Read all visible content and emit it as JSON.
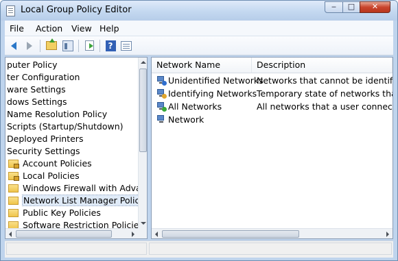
{
  "window": {
    "title": "Local Group Policy Editor"
  },
  "titlebar_buttons": {
    "minimize": "‒",
    "maximize": "□",
    "close": "✕"
  },
  "menu": [
    "File",
    "Action",
    "View",
    "Help"
  ],
  "toolbar": {
    "help_glyph": "?"
  },
  "tree": {
    "items": [
      {
        "label": "puter Policy",
        "icon": "none"
      },
      {
        "label": "ter Configuration",
        "icon": "none"
      },
      {
        "label": "ware Settings",
        "icon": "none"
      },
      {
        "label": "dows Settings",
        "icon": "none"
      },
      {
        "label": "Name Resolution Policy",
        "icon": "none"
      },
      {
        "label": "Scripts (Startup/Shutdown)",
        "icon": "none"
      },
      {
        "label": "Deployed Printers",
        "icon": "none"
      },
      {
        "label": "Security Settings",
        "icon": "none"
      },
      {
        "label": "Account Policies",
        "icon": "locked-folder-icon"
      },
      {
        "label": "Local Policies",
        "icon": "locked-folder-icon"
      },
      {
        "label": "Windows Firewall with Advanced",
        "icon": "folder-icon"
      },
      {
        "label": "Network List Manager Policies",
        "icon": "folder-icon",
        "selected": true
      },
      {
        "label": "Public Key Policies",
        "icon": "folder-icon"
      },
      {
        "label": "Software Restriction Policies",
        "icon": "folder-icon"
      }
    ]
  },
  "list": {
    "columns": [
      "Network Name",
      "Description"
    ],
    "rows": [
      {
        "name": "Unidentified Networks",
        "description": "Networks that cannot be identified du",
        "icon": "network-unidentified-icon"
      },
      {
        "name": "Identifying Networks",
        "description": "Temporary state of networks that are",
        "icon": "network-identifying-icon"
      },
      {
        "name": "All Networks",
        "description": "All networks that a user connects to.",
        "icon": "network-all-icon"
      },
      {
        "name": "Network",
        "description": "",
        "icon": "network-icon"
      }
    ]
  },
  "colors": {
    "window_frame": "#bfd4ed",
    "selection": "#dfeaf7",
    "close_button": "#c9452d"
  }
}
